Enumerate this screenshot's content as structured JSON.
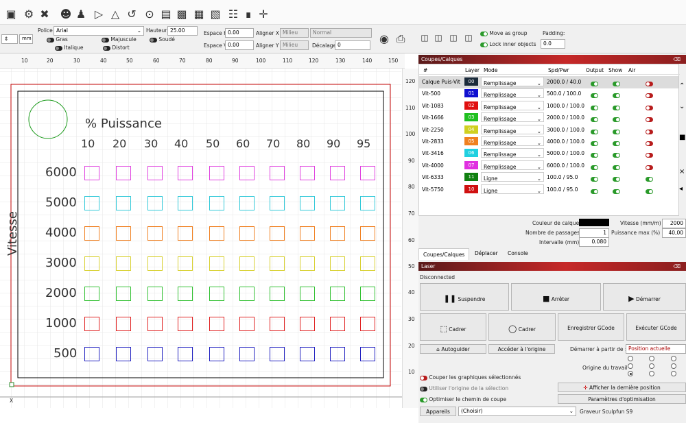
{
  "toolbar": {
    "icons": [
      "monitor-icon",
      "gear-icon",
      "tools-icon",
      "users-icon",
      "user-icon",
      "flip-icon",
      "mirror-icon",
      "rotate-icon",
      "target-icon",
      "align-icon",
      "align2-icon",
      "distribute-icon",
      "distribute2-icon",
      "grid-icon",
      "crosshair-icon"
    ]
  },
  "text_options": {
    "font_label": "Police",
    "font_value": "Arial",
    "height_label": "Hauteur",
    "height_value": "25.00",
    "hspace_label": "Espace H",
    "hspace_value": "0.00",
    "vspace_label": "Espace V",
    "vspace_value": "0.00",
    "alignx_label": "Aligner X",
    "alignx_value": "Milieu",
    "aligny_label": "Aligner Y",
    "aligny_value": "Milieu",
    "normal_value": "Normal",
    "offset_label": "Décalage",
    "offset_value": "0",
    "bold": "Gras",
    "upper": "Majuscule",
    "welded": "Soudé",
    "italic": "Italique",
    "distort": "Distort",
    "unit": "mm"
  },
  "group_options": {
    "move_as_group": "Move as group",
    "lock_inner": "Lock inner objects",
    "padding_label": "Padding:",
    "padding_value": "0.0"
  },
  "ruler": {
    "top": [
      "10",
      "20",
      "30",
      "40",
      "50",
      "60",
      "70",
      "80",
      "90",
      "100",
      "110",
      "120",
      "130",
      "140",
      "150"
    ],
    "right": [
      "120",
      "110",
      "100",
      "90",
      "80",
      "70",
      "60",
      "50",
      "40",
      "30",
      "20",
      "10"
    ],
    "x_axis": "X"
  },
  "canvas": {
    "title": "% Puissance",
    "ylabel": "Vitesse",
    "powers": [
      "10",
      "20",
      "30",
      "40",
      "50",
      "60",
      "70",
      "80",
      "90",
      "95"
    ],
    "speeds": [
      {
        "label": "6000",
        "color": "#e040e0"
      },
      {
        "label": "5000",
        "color": "#30c8d8"
      },
      {
        "label": "4000",
        "color": "#f08020"
      },
      {
        "label": "3000",
        "color": "#d8d030"
      },
      {
        "label": "2000",
        "color": "#30c030"
      },
      {
        "label": "1000",
        "color": "#e02020"
      },
      {
        "label": "500",
        "color": "#2020c0"
      }
    ]
  },
  "layers_panel": {
    "title": "Coupes/Calques",
    "headers": [
      "#",
      "Layer",
      "Mode",
      "Spd/Pwr",
      "Output",
      "Show",
      "Air"
    ],
    "rows": [
      {
        "name": "Calque Puis-Vit",
        "num": "00",
        "color": "#1a2a3a",
        "mode": "Remplissage",
        "spd": "2000.0 / 40.0",
        "air": "off"
      },
      {
        "name": "Vit-500",
        "num": "01",
        "color": "#1010d0",
        "mode": "Remplissage",
        "spd": "500.0 / 100.0",
        "air": "off"
      },
      {
        "name": "Vit-1083",
        "num": "02",
        "color": "#e01010",
        "mode": "Remplissage",
        "spd": "1000.0 / 100.0",
        "air": "off"
      },
      {
        "name": "Vit-1666",
        "num": "03",
        "color": "#20c020",
        "mode": "Remplissage",
        "spd": "2000.0 / 100.0",
        "air": "off"
      },
      {
        "name": "Vit-2250",
        "num": "04",
        "color": "#d0d020",
        "mode": "Remplissage",
        "spd": "3000.0 / 100.0",
        "air": "off"
      },
      {
        "name": "Vit-2833",
        "num": "05",
        "color": "#f08020",
        "mode": "Remplissage",
        "spd": "4000.0 / 100.0",
        "air": "off"
      },
      {
        "name": "Vit-3416",
        "num": "06",
        "color": "#20d0e0",
        "mode": "Remplissage",
        "spd": "5000.0 / 100.0",
        "air": "off"
      },
      {
        "name": "Vit-4000",
        "num": "07",
        "color": "#e030e0",
        "mode": "Remplissage",
        "spd": "6000.0 / 100.0",
        "air": "off"
      },
      {
        "name": "Vit-6333",
        "num": "11",
        "color": "#108010",
        "mode": "Ligne",
        "spd": "100.0 / 95.0",
        "air": "on"
      },
      {
        "name": "Vit-5750",
        "num": "10",
        "color": "#d01010",
        "mode": "Ligne",
        "spd": "100.0 / 95.0",
        "air": "on"
      }
    ],
    "layer_color_label": "Couleur de calque",
    "passes_label": "Nombre de passages",
    "passes_value": "1",
    "interval_label": "Intervalle (mm)",
    "interval_value": "0.080",
    "speed_label": "Vitesse (mm/m)",
    "speed_value": "2000",
    "maxpower_label": "Puissance max (%)",
    "maxpower_value": "40,00"
  },
  "tabs": [
    "Coupes/Calques",
    "Déplacer",
    "Console"
  ],
  "laser_panel": {
    "title": "Laser",
    "status": "Disconnected",
    "pause": "Suspendre",
    "stop": "Arrêter",
    "start": "Démarrer",
    "frame": "Cadrer",
    "frame_circle": "Cadrer",
    "save_gcode": "Enregistrer GCode",
    "run_gcode": "Exécuter GCode",
    "home": "Autoguider",
    "go_origin": "Accéder à l'origine",
    "start_from_label": "Démarrer à partir de :",
    "start_from_value": "Position actuelle",
    "job_origin_label": "Origine du travail",
    "cut_selected": "Couper les graphiques sélectionnés",
    "use_origin": "Utiliser l'origine de la sélection",
    "optimize": "Optimiser le chemin de coupe",
    "show_last": "Afficher la dernière position",
    "optim_settings": "Paramètres d'optimisation",
    "devices": "Appareils",
    "device_select": "(Choisir)",
    "device_name": "Graveur Sculpfun S9"
  }
}
